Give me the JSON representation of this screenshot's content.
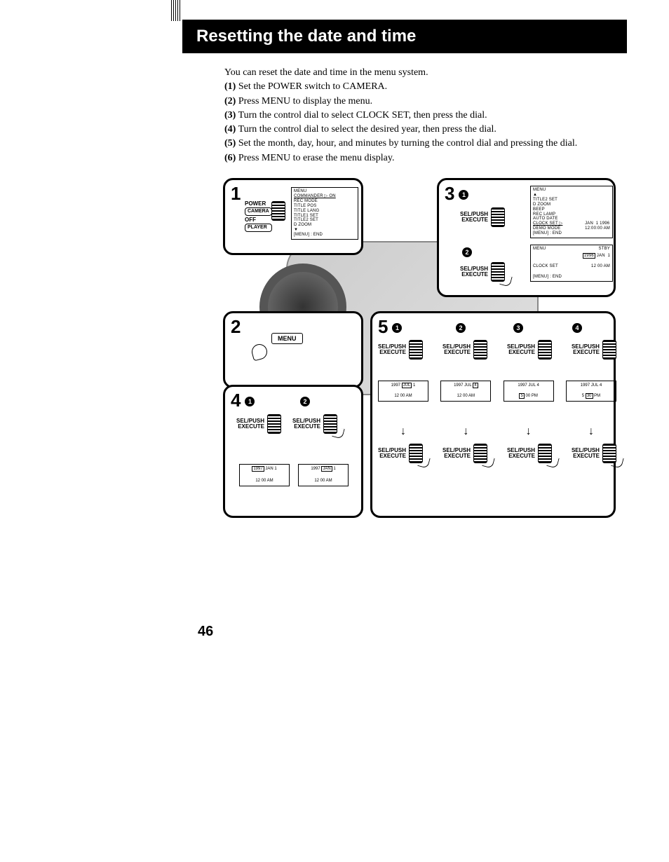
{
  "title": "Resetting the date and time",
  "intro": "You can reset the date and time in the menu system.",
  "steps": [
    {
      "n": "(1)",
      "t": "Set the POWER switch to CAMERA."
    },
    {
      "n": "(2)",
      "t": "Press MENU to display the menu."
    },
    {
      "n": "(3)",
      "t": "Turn the control dial to select CLOCK SET, then press the dial."
    },
    {
      "n": "(4)",
      "t": "Turn the control dial to select the desired year, then press the dial."
    },
    {
      "n": "(5)",
      "t": "Set the month, day, hour, and minutes by turning the control dial and pressing the dial."
    },
    {
      "n": "(6)",
      "t": "Press MENU to erase the menu display."
    }
  ],
  "power_labels": {
    "power": "POWER",
    "camera": "CAMERA",
    "off": "OFF",
    "player": "PLAYER"
  },
  "menu_label": "MENU",
  "selpush": "SEL/PUSH",
  "execute": "EXECUTE",
  "clock_set": "CLOCK SET",
  "menu_end": "[MENU] : END",
  "stby": "STBY",
  "menu1": [
    "MENU",
    "COMMANDER ▷ ON",
    "REC MODE",
    "TITLE POS",
    "TITLE LANG",
    "TITLE1 SET",
    "TITLE2 SET",
    "D ZOOM",
    "▼",
    "[MENU] : END"
  ],
  "menu3a": [
    "MENU",
    "▲",
    "TITLE2 SET",
    "D ZOOM",
    "BEEP",
    "REC LAMP",
    "AUTO DATE",
    "CLOCK SET ▷",
    "DEMO MODE",
    "",
    "[MENU] : END"
  ],
  "menu3a_val": "JAN  1 1996\n12:00:00 AM",
  "menu3b_date": "1996 JAN  1",
  "menu3b_time": "12 00 AM",
  "p4_sub1_date": "1997 JAN  1",
  "p4_sub1_time": "12 00 AM",
  "p4_sub2_date": "1997 JAN  1",
  "p4_sub2_time": "12 00 AM",
  "p5": [
    {
      "d1": "1997 JUL 1",
      "t1": "12 00 AM"
    },
    {
      "d1": "1997 JUL 4",
      "t1": "12 00 AM"
    },
    {
      "d1": "1997 JUL 4",
      "t1": "5 00 PM"
    },
    {
      "d1": "1997 JUL 4",
      "t1": "5 30 PM"
    }
  ],
  "page_number": "46"
}
